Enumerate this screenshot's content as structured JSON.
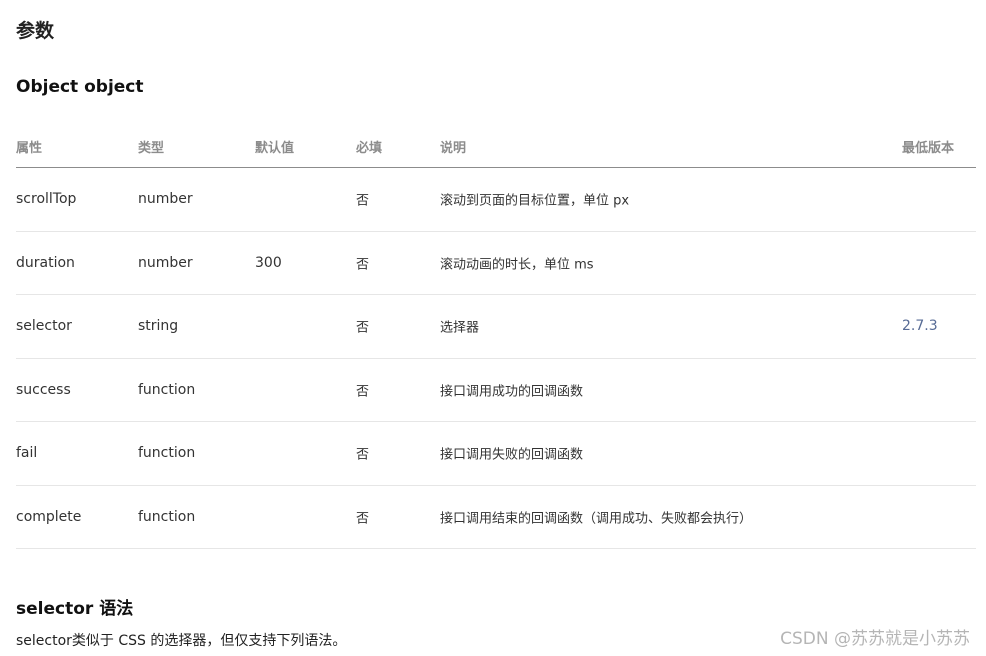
{
  "section_title": "参数",
  "object_title": "Object object",
  "table": {
    "headers": [
      "属性",
      "类型",
      "默认值",
      "必填",
      "说明",
      "最低版本"
    ],
    "rows": [
      {
        "name": "scrollTop",
        "type": "number",
        "default": "",
        "required": "否",
        "desc": "滚动到页面的目标位置，单位 px",
        "version": ""
      },
      {
        "name": "duration",
        "type": "number",
        "default": "300",
        "required": "否",
        "desc": "滚动动画的时长，单位 ms",
        "version": ""
      },
      {
        "name": "selector",
        "type": "string",
        "default": "",
        "required": "否",
        "desc": "选择器",
        "version": "2.7.3"
      },
      {
        "name": "success",
        "type": "function",
        "default": "",
        "required": "否",
        "desc": "接口调用成功的回调函数",
        "version": ""
      },
      {
        "name": "fail",
        "type": "function",
        "default": "",
        "required": "否",
        "desc": "接口调用失败的回调函数",
        "version": ""
      },
      {
        "name": "complete",
        "type": "function",
        "default": "",
        "required": "否",
        "desc": "接口调用结束的回调函数（调用成功、失败都会执行）",
        "version": ""
      }
    ]
  },
  "selector_title": "selector 语法",
  "selector_desc": "selector类似于 CSS 的选择器，但仅支持下列语法。",
  "watermark": "CSDN @苏苏就是小苏苏"
}
